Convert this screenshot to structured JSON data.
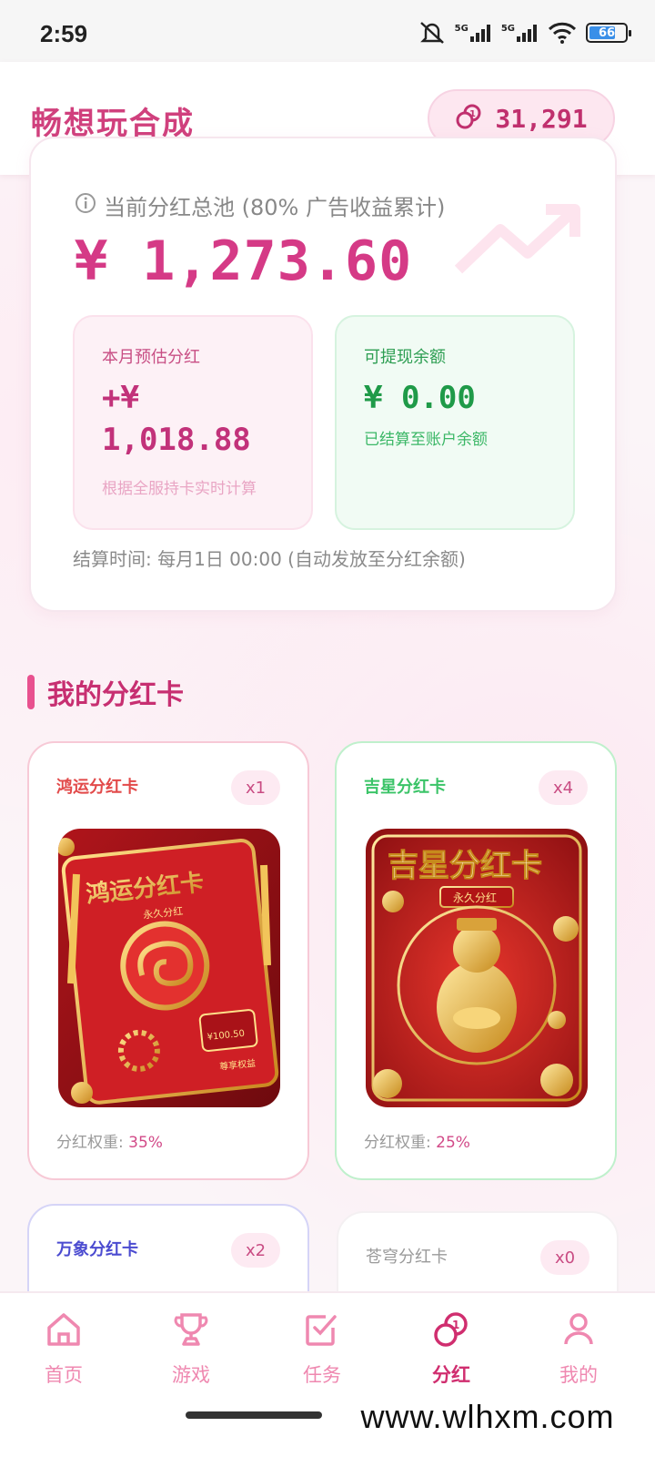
{
  "status_bar": {
    "time": "2:59",
    "battery": "66",
    "signal_1": "5G",
    "signal_2": "5G"
  },
  "header": {
    "title": "畅想玩合成",
    "coins": "31,291"
  },
  "pool": {
    "label": "当前分红总池 (80% 广告收益累计)",
    "amount": "¥ 1,273.60",
    "monthly": {
      "label": "本月预估分红",
      "value_line1": "+¥",
      "value_line2": "1,018.88",
      "note": "根据全服持卡实时计算"
    },
    "withdrawable": {
      "label": "可提现余额",
      "value": "¥ 0.00",
      "note": "已结算至账户余额"
    },
    "settle_time": "结算时间: 每月1日 00:00 (自动发放至分红余额)"
  },
  "section": {
    "title": "我的分红卡"
  },
  "cards": [
    {
      "name": "鸿运分红卡",
      "count": "x1",
      "weight_label": "分红权重:",
      "weight": "35%",
      "art_title": "鸿运分红卡",
      "art_sub": "永久分红",
      "art_amount": "¥100.50",
      "art_tag": "尊享权益"
    },
    {
      "name": "吉星分红卡",
      "count": "x4",
      "weight_label": "分红权重:",
      "weight": "25%",
      "art_title": "吉星分红卡",
      "art_sub": "永久分红"
    },
    {
      "name": "万象分红卡",
      "count": "x2"
    },
    {
      "name": "苍穹分红卡",
      "count": "x0"
    }
  ],
  "nav": [
    {
      "label": "首页",
      "icon": "home-icon"
    },
    {
      "label": "游戏",
      "icon": "trophy-icon"
    },
    {
      "label": "任务",
      "icon": "task-check-icon"
    },
    {
      "label": "分红",
      "icon": "coins-icon"
    },
    {
      "label": "我的",
      "icon": "user-icon"
    }
  ],
  "watermark": "www.wlhxm.com",
  "colors": {
    "brand_pink": "#d0407d",
    "accent_green": "#1f9a48"
  }
}
